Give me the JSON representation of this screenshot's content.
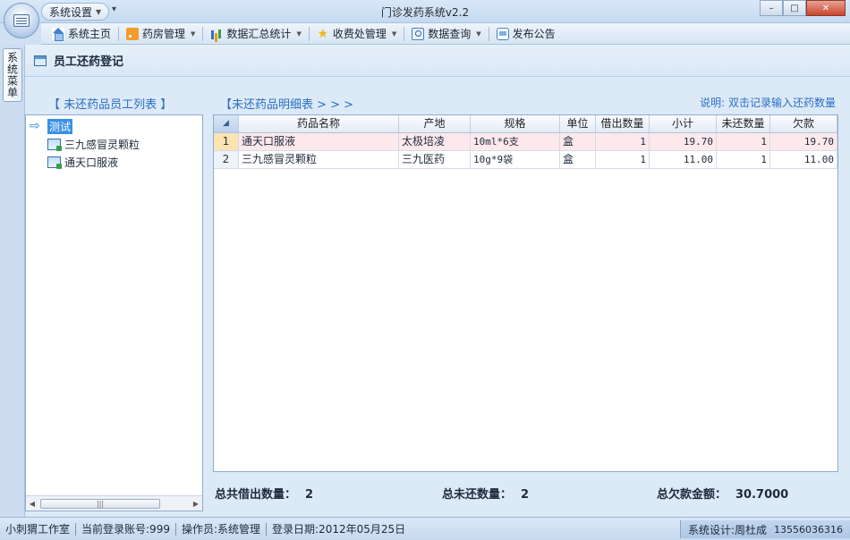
{
  "window": {
    "title": "门诊发药系统v2.2",
    "quick_access_label": "系统设置",
    "buttons": {
      "minimize": "–",
      "maximize": "□",
      "close": "✕"
    }
  },
  "menu": {
    "items": [
      {
        "label": "系统主页",
        "icon": "home-icon",
        "dropdown": false
      },
      {
        "label": "药房管理",
        "icon": "rss-icon",
        "dropdown": true
      },
      {
        "label": "数据汇总统计",
        "icon": "bar-chart-icon",
        "dropdown": true
      },
      {
        "label": "收费处管理",
        "icon": "star-icon",
        "dropdown": true
      },
      {
        "label": "数据查询",
        "icon": "query-icon",
        "dropdown": true
      },
      {
        "label": "发布公告",
        "icon": "chat-icon",
        "dropdown": false
      }
    ]
  },
  "side_tab": {
    "label": "系统菜单"
  },
  "page": {
    "title": "员工还药登记",
    "left_section": "【 未还药品员工列表 】",
    "mid_section": "【未还药品明细表 > > >",
    "hint": "说明: 双击记录输入还药数量"
  },
  "tree": {
    "root": "测试",
    "children": [
      "三九感冒灵颗粒",
      "通天口服液"
    ]
  },
  "grid": {
    "columns": [
      "药品名称",
      "产地",
      "规格",
      "单位",
      "借出数量",
      "小计",
      "未还数量",
      "欠款"
    ],
    "rows": [
      {
        "no": "1",
        "name": "通天口服液",
        "origin": "太极培凌",
        "spec": "10ml*6支",
        "unit": "盒",
        "lent": "1",
        "subtotal": "19.70",
        "unreturned": "1",
        "debt": "19.70"
      },
      {
        "no": "2",
        "name": "三九感冒灵颗粒",
        "origin": "三九医药",
        "spec": "10g*9袋",
        "unit": "盒",
        "lent": "1",
        "subtotal": "11.00",
        "unreturned": "1",
        "debt": "11.00"
      }
    ]
  },
  "totals": {
    "lent_label": "总共借出数量：",
    "lent_value": "2",
    "unreturned_label": "总未还数量：",
    "unreturned_value": "2",
    "debt_label": "总欠款金额：",
    "debt_value": "30.7000"
  },
  "status": {
    "studio": "小刺猬工作室",
    "account": "当前登录账号:999",
    "operator": "操作员:系统管理",
    "login_date": "登录日期:2012年05月25日",
    "designer": "系统设计:周杜成",
    "phone": "13556036316"
  }
}
